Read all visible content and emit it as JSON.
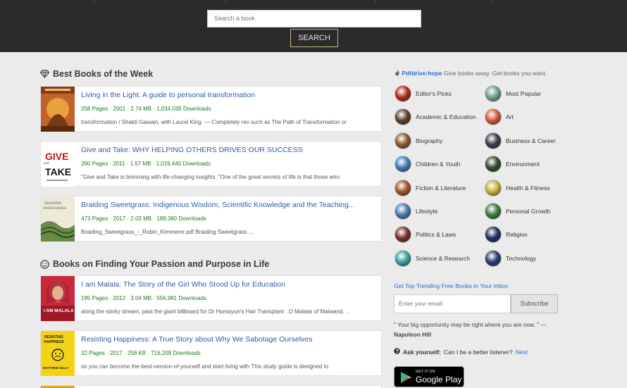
{
  "search": {
    "placeholder": "Search a book",
    "button_label": "SEARCH"
  },
  "sections": [
    {
      "title": "Best Books of the Week",
      "icon": "diamond-icon",
      "books": [
        {
          "title": "Living in the Light: A guide to personal transformation",
          "pages": "258 Pages",
          "year": "2001",
          "size": "2.74 MB",
          "downloads": "1,034,035 Downloads",
          "description": "transformation / Shakti Gawain, with Laurel King. — Completely rev such as The Path of Transformation or"
        },
        {
          "title": "Give and Take: WHY HELPING OTHERS DRIVES OUR SUCCESS",
          "pages": "260 Pages",
          "year": "2011",
          "size": "1.57 MB",
          "downloads": "1,019,440 Downloads",
          "description": "\"Give and Take is brimming with life-changing insights. \"One of the great secrets of life is that those who",
          "cover_text": [
            "GIVE",
            "TAKE"
          ]
        },
        {
          "title": "Braiding Sweetgrass: Indigenous Wisdom, Scientific Knowledge and the Teaching...",
          "pages": "473 Pages",
          "year": "2017",
          "size": "2.03 MB",
          "downloads": "189,380 Downloads",
          "description": "Braiding_Sweetgrass_-_Robin_Kimmerer.pdf Braiding Sweetgrass  ...",
          "cover_text": [
            "BRAIDING",
            "SWEETGRASS"
          ]
        }
      ]
    },
    {
      "title": "Books on Finding Your Passion and Purpose in Life",
      "icon": "smile-icon",
      "books": [
        {
          "title": "I am Malala: The Story of the Girl Who Stood Up for Education",
          "pages": "195 Pages",
          "year": "2012",
          "size": "3.04 MB",
          "downloads": "556,981 Downloads",
          "description": "along the stinky stream, past the giant billboard for Dr Humayun's Hair Transplant . O Malalai of Maiwand, ..",
          "cover_text": [
            "I AM MALALA"
          ]
        },
        {
          "title": "Resisting Happiness: A True Story about Why We Sabotage Ourselves",
          "pages": "32 Pages",
          "year": "2017",
          "size": "258 KB",
          "downloads": "716,209 Downloads",
          "description": "so you can become the-best-version-of-yourself and start living with This study guide is designed to",
          "cover_text": [
            "RESISTING",
            "HAPPINESS",
            "MATTHEW KELLY"
          ]
        }
      ]
    }
  ],
  "sidebar": {
    "promo_brand": "Pdfdrive:hope",
    "promo_text": "Give books away. Get books you want.",
    "categories": [
      {
        "label": "Editor's Picks",
        "color": "#b3261e"
      },
      {
        "label": "Most Popular",
        "color": "#6fa08a"
      },
      {
        "label": "Academic & Education",
        "color": "#5a3e2b"
      },
      {
        "label": "Art",
        "color": "#d9533a"
      },
      {
        "label": "Biography",
        "color": "#8a5a2b"
      },
      {
        "label": "Business & Career",
        "color": "#3a3a4a"
      },
      {
        "label": "Children & Youth",
        "color": "#3f7ab8"
      },
      {
        "label": "Environment",
        "color": "#2e4a2e"
      },
      {
        "label": "Fiction & Literature",
        "color": "#a0522d"
      },
      {
        "label": "Health & Fitness",
        "color": "#c7b23a"
      },
      {
        "label": "Lifestyle",
        "color": "#4a7ab0"
      },
      {
        "label": "Personal Growth",
        "color": "#3f7a3f"
      },
      {
        "label": "Politics & Laws",
        "color": "#7a2e2e"
      },
      {
        "label": "Religion",
        "color": "#1f2f5a"
      },
      {
        "label": "Science & Research",
        "color": "#3aa0a0"
      },
      {
        "label": "Technology",
        "color": "#2a3a6a"
      }
    ],
    "newsletter_title": "Get Top Trending Free Books in Your Inbox",
    "email_placeholder": "Enter your email",
    "subscribe_label": "Subscribe",
    "quote_text": "\" Your big opportunity may be right where you are now. \" —",
    "quote_author": "Napoleon Hill",
    "ask_label": "Ask yourself:",
    "ask_text": "Can I be a better listener?",
    "next_label": "Next",
    "gplay_small": "GET IT ON",
    "gplay_big": "Google Play"
  }
}
